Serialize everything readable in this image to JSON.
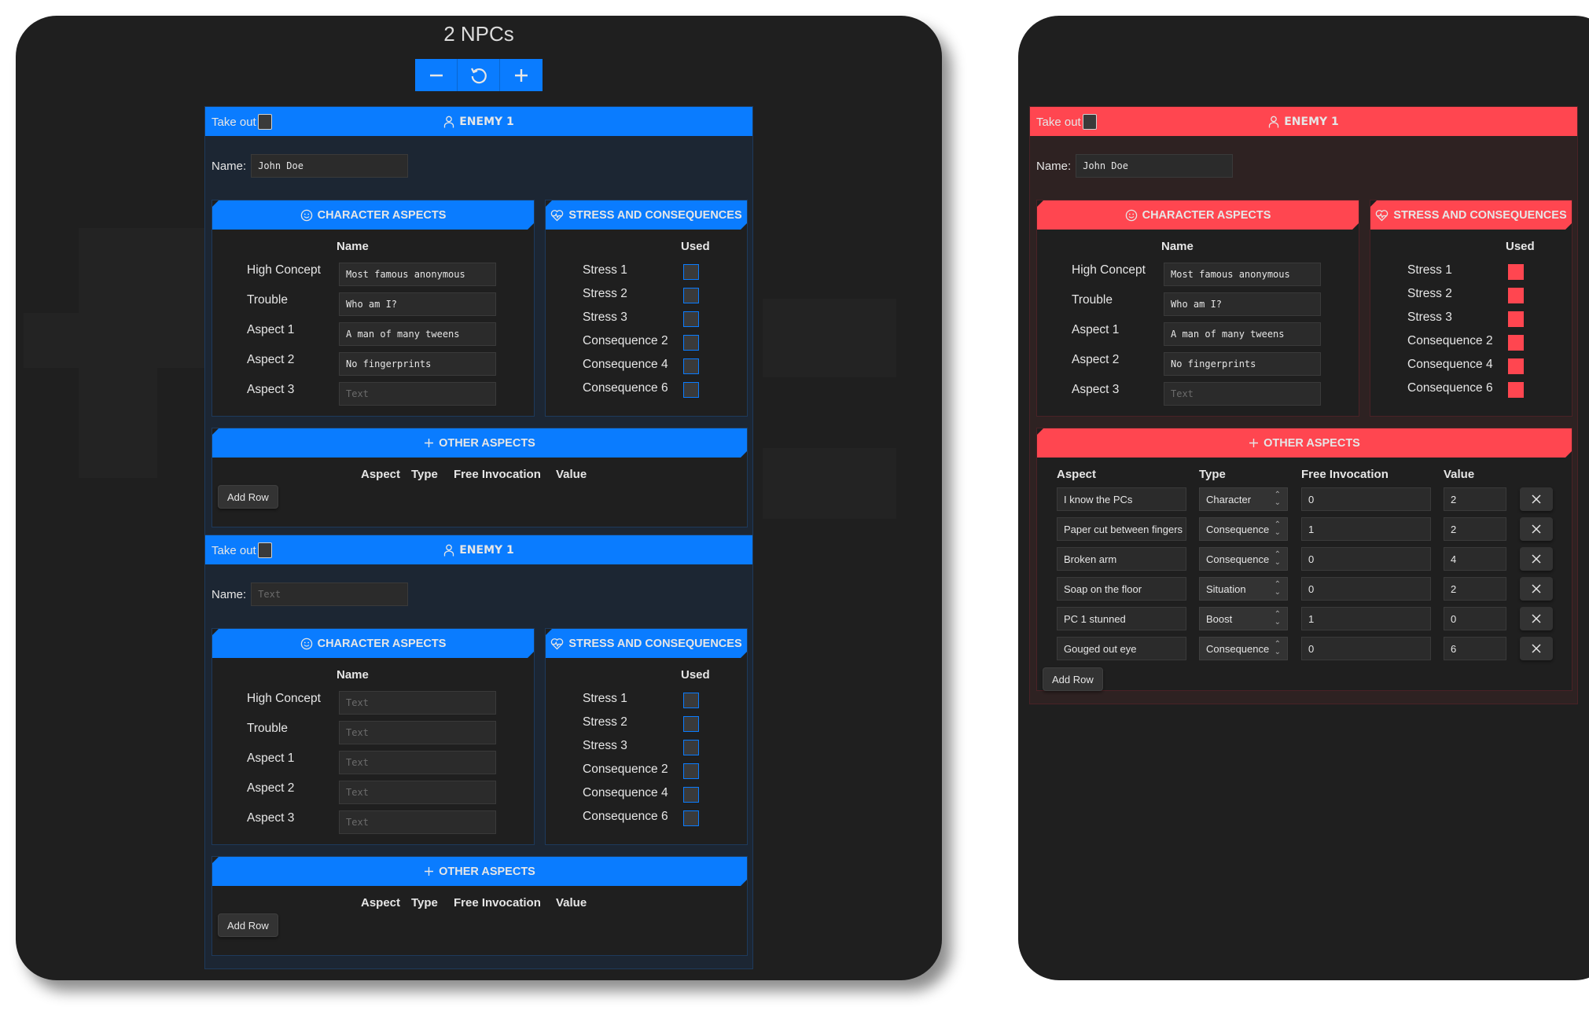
{
  "npc_view": {
    "title": "2 NPCs",
    "controls": [
      {
        "name": "remove-npc-button",
        "icon": "minus-icon"
      },
      {
        "name": "reset-button",
        "icon": "rotate-ccw-icon"
      },
      {
        "name": "add-npc-button",
        "icon": "plus-icon"
      }
    ],
    "cards": [
      {
        "theme": "blue",
        "take_out_label": "Take out",
        "take_out_checked": false,
        "header_title": "ENEMY 1",
        "name_label": "Name:",
        "name_value": "John Doe",
        "name_placeholder": "Text",
        "character_aspects": {
          "title": "CHARACTER ASPECTS",
          "column_header": "Name",
          "rows": [
            {
              "label": "High Concept",
              "value": "Most famous anonymous",
              "placeholder": "Text"
            },
            {
              "label": "Trouble",
              "value": "Who am I?",
              "placeholder": "Text"
            },
            {
              "label": "Aspect 1",
              "value": "A man of many tweens",
              "placeholder": "Text"
            },
            {
              "label": "Aspect 2",
              "value": "No fingerprints",
              "placeholder": "Text"
            },
            {
              "label": "Aspect 3",
              "value": "",
              "placeholder": "Text"
            }
          ]
        },
        "stress": {
          "title": "STRESS AND CONSEQUENCES",
          "column_header": "Used",
          "rows": [
            {
              "label": "Stress 1",
              "used": false
            },
            {
              "label": "Stress 2",
              "used": false
            },
            {
              "label": "Stress 3",
              "used": false
            },
            {
              "label": "Consequence 2",
              "used": false
            },
            {
              "label": "Consequence 4",
              "used": false
            },
            {
              "label": "Consequence 6",
              "used": false
            }
          ]
        },
        "other_aspects": {
          "title": "OTHER ASPECTS",
          "headers": [
            "Aspect",
            "Type",
            "Free Invocation",
            "Value"
          ],
          "rows": [],
          "add_row_label": "Add Row"
        }
      },
      {
        "theme": "blue",
        "take_out_label": "Take out",
        "take_out_checked": false,
        "header_title": "ENEMY 1",
        "name_label": "Name:",
        "name_value": "",
        "name_placeholder": "Text",
        "character_aspects": {
          "title": "CHARACTER ASPECTS",
          "column_header": "Name",
          "rows": [
            {
              "label": "High Concept",
              "value": "",
              "placeholder": "Text"
            },
            {
              "label": "Trouble",
              "value": "",
              "placeholder": "Text"
            },
            {
              "label": "Aspect 1",
              "value": "",
              "placeholder": "Text"
            },
            {
              "label": "Aspect 2",
              "value": "",
              "placeholder": "Text"
            },
            {
              "label": "Aspect 3",
              "value": "",
              "placeholder": "Text"
            }
          ]
        },
        "stress": {
          "title": "STRESS AND CONSEQUENCES",
          "column_header": "Used",
          "rows": [
            {
              "label": "Stress 1",
              "used": false
            },
            {
              "label": "Stress 2",
              "used": false
            },
            {
              "label": "Stress 3",
              "used": false
            },
            {
              "label": "Consequence 2",
              "used": false
            },
            {
              "label": "Consequence 4",
              "used": false
            },
            {
              "label": "Consequence 6",
              "used": false
            }
          ]
        },
        "other_aspects": {
          "title": "OTHER ASPECTS",
          "headers": [
            "Aspect",
            "Type",
            "Free Invocation",
            "Value"
          ],
          "rows": [],
          "add_row_label": "Add Row"
        }
      }
    ]
  },
  "detail_view": {
    "card": {
      "theme": "red",
      "take_out_label": "Take out",
      "take_out_checked": false,
      "header_title": "ENEMY 1",
      "name_label": "Name:",
      "name_value": "John Doe",
      "name_placeholder": "Text",
      "character_aspects": {
        "title": "CHARACTER ASPECTS",
        "column_header": "Name",
        "rows": [
          {
            "label": "High Concept",
            "value": "Most famous anonymous",
            "placeholder": "Text"
          },
          {
            "label": "Trouble",
            "value": "Who am I?",
            "placeholder": "Text"
          },
          {
            "label": "Aspect 1",
            "value": "A man of many tweens",
            "placeholder": "Text"
          },
          {
            "label": "Aspect 2",
            "value": "No fingerprints",
            "placeholder": "Text"
          },
          {
            "label": "Aspect 3",
            "value": "",
            "placeholder": "Text"
          }
        ]
      },
      "stress": {
        "title": "STRESS AND CONSEQUENCES",
        "column_header": "Used",
        "rows": [
          {
            "label": "Stress 1",
            "used": true
          },
          {
            "label": "Stress 2",
            "used": true
          },
          {
            "label": "Stress 3",
            "used": true
          },
          {
            "label": "Consequence 2",
            "used": true
          },
          {
            "label": "Consequence 4",
            "used": true
          },
          {
            "label": "Consequence 6",
            "used": true
          }
        ]
      },
      "other_aspects": {
        "title": "OTHER ASPECTS",
        "headers": [
          "Aspect",
          "Type",
          "Free Invocation",
          "Value"
        ],
        "rows": [
          {
            "aspect": "I know the PCs",
            "type": "Character",
            "free_invocation": "0",
            "value": "2"
          },
          {
            "aspect": "Paper cut between fingers",
            "type": "Consequence",
            "free_invocation": "1",
            "value": "2"
          },
          {
            "aspect": "Broken arm",
            "type": "Consequence",
            "free_invocation": "0",
            "value": "4"
          },
          {
            "aspect": "Soap on the floor",
            "type": "Situation",
            "free_invocation": "0",
            "value": "2"
          },
          {
            "aspect": "PC 1 stunned",
            "type": "Boost",
            "free_invocation": "1",
            "value": "0"
          },
          {
            "aspect": "Gouged out eye",
            "type": "Consequence",
            "free_invocation": "0",
            "value": "6"
          }
        ],
        "add_row_label": "Add Row",
        "remove_row_icon": "close-icon"
      }
    }
  },
  "colors": {
    "blue_accent": "#0a7cff",
    "red_accent": "#ff4650",
    "panel_bg": "#1f1f1f"
  }
}
